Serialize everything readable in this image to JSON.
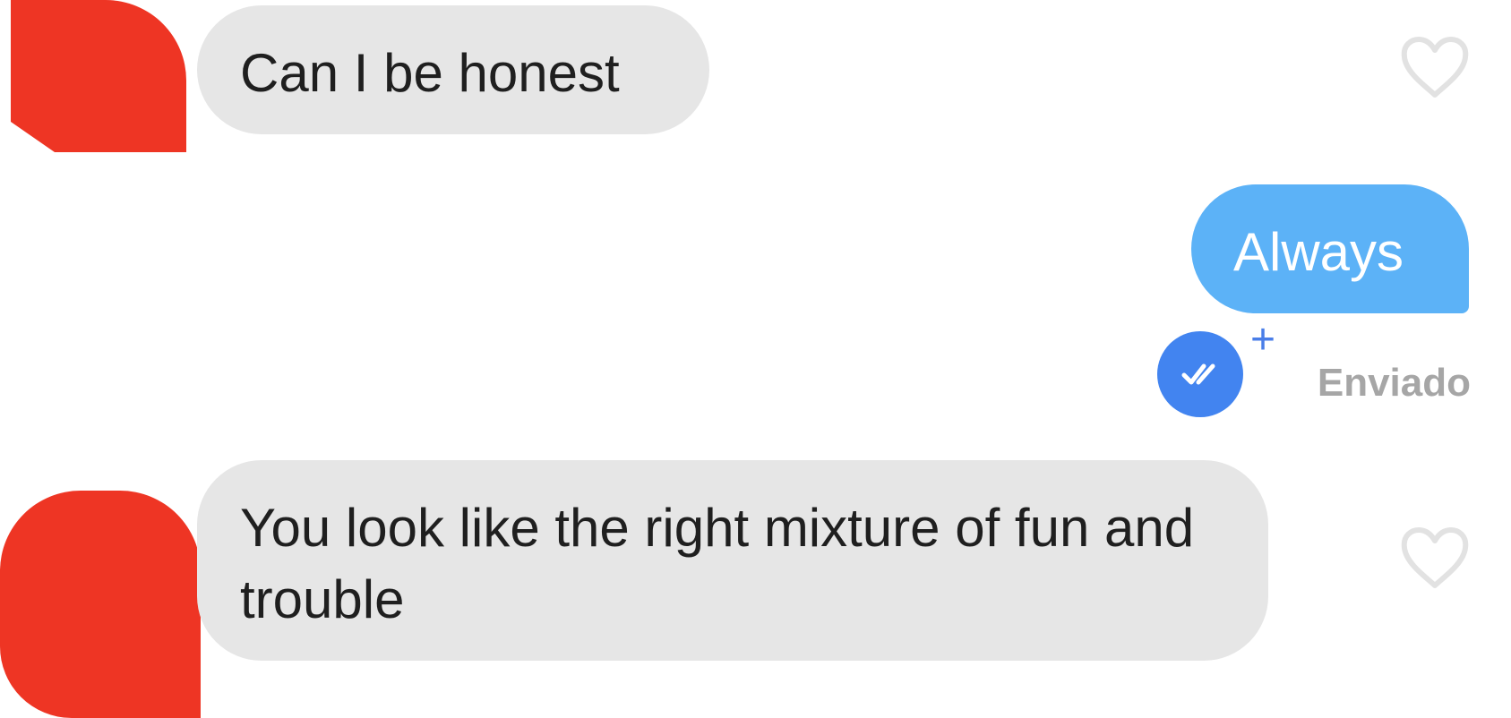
{
  "conversation": {
    "messages": [
      {
        "text": "Can I be honest",
        "direction": "incoming",
        "liked": false
      },
      {
        "text": "Always",
        "direction": "outgoing"
      },
      {
        "text": "You look like the right mixture of fun and trouble",
        "direction": "incoming",
        "liked": false
      }
    ],
    "status": {
      "label": "Enviado",
      "read_icon": "double-check-icon",
      "plus_icon": "+"
    }
  },
  "colors": {
    "incoming_bubble": "#e6e6e6",
    "outgoing_bubble": "#5cb2f7",
    "read_badge": "#4284f0",
    "redaction": "#ee3524",
    "status_text": "#a6a6a6"
  }
}
